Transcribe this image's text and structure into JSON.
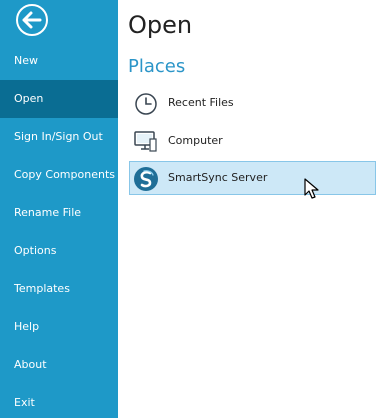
{
  "sidebar": {
    "back_icon": "arrow-left-circle-icon",
    "items": [
      {
        "label": "New"
      },
      {
        "label": "Open",
        "active": true
      },
      {
        "label": "Sign In/Sign Out"
      },
      {
        "label": "Copy Components"
      },
      {
        "label": "Rename File"
      },
      {
        "label": "Options"
      },
      {
        "label": "Templates"
      },
      {
        "label": "Help"
      },
      {
        "label": "About"
      },
      {
        "label": "Exit"
      }
    ]
  },
  "main": {
    "title": "Open",
    "section_title": "Places",
    "places": [
      {
        "label": "Recent Files",
        "icon": "clock-icon"
      },
      {
        "label": "Computer",
        "icon": "computer-icon"
      },
      {
        "label": "SmartSync Server",
        "icon": "smartsync-icon",
        "selected": true
      }
    ]
  },
  "colors": {
    "sidebar_background": "#1e99c8",
    "sidebar_active": "#0a6d93",
    "accent_text": "#2b95c8",
    "selected_background": "#cde8f7",
    "selected_border": "#88c6e8"
  }
}
